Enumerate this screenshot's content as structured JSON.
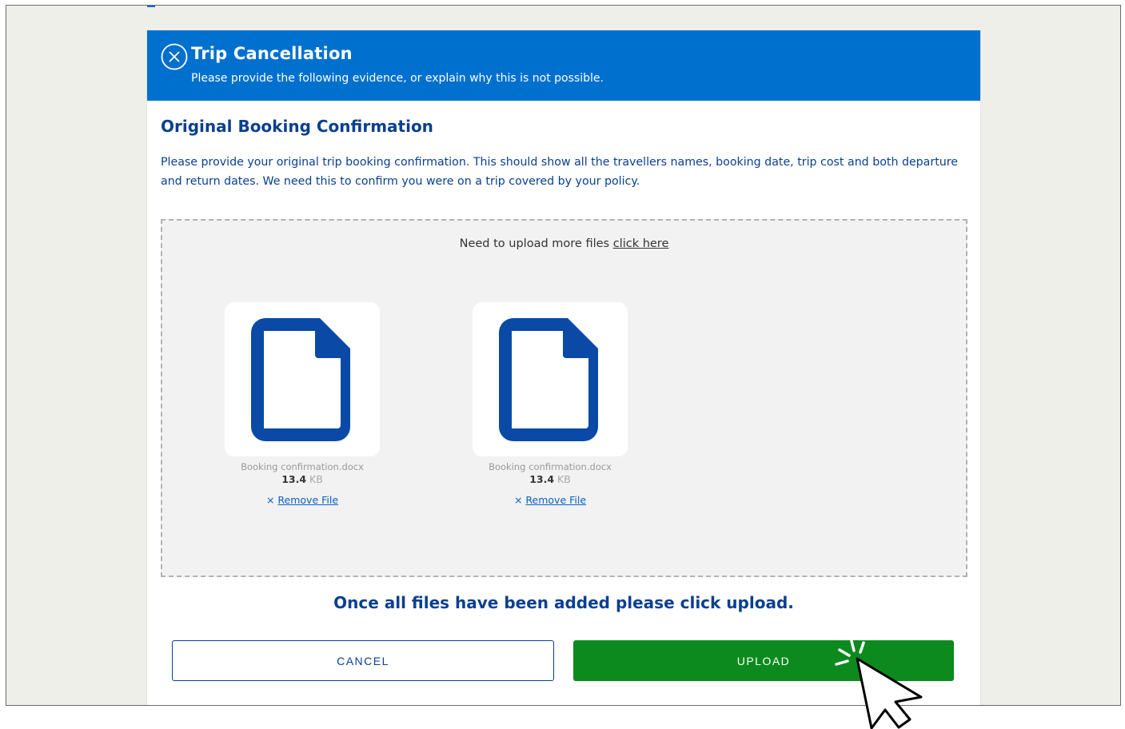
{
  "header": {
    "title": "Trip Cancellation",
    "subtitle": "Please provide the following evidence, or explain why this is not possible."
  },
  "section": {
    "title": "Original Booking Confirmation",
    "description": "Please provide your original trip booking confirmation. This should show all the travellers names, booking date, trip cost and both departure and return dates. We need this to confirm you were on a trip covered by your policy."
  },
  "dropzone": {
    "prompt": "Need to upload more files",
    "link": "click here"
  },
  "files": [
    {
      "name": "Booking confirmation.docx",
      "size": "13.4",
      "unit": "KB",
      "remove_symbol": "×",
      "remove_label": "Remove File"
    },
    {
      "name": "Booking confirmation.docx",
      "size": "13.4",
      "unit": "KB",
      "remove_symbol": "×",
      "remove_label": "Remove File"
    }
  ],
  "instruction": "Once all files have been added please click upload.",
  "buttons": {
    "cancel": "CANCEL",
    "upload": "UPLOAD"
  },
  "colors": {
    "header_bg": "#0070cf",
    "heading_text": "#0a3f91",
    "upload_bg": "#0c8a1e",
    "file_icon": "#0a4aa6"
  }
}
